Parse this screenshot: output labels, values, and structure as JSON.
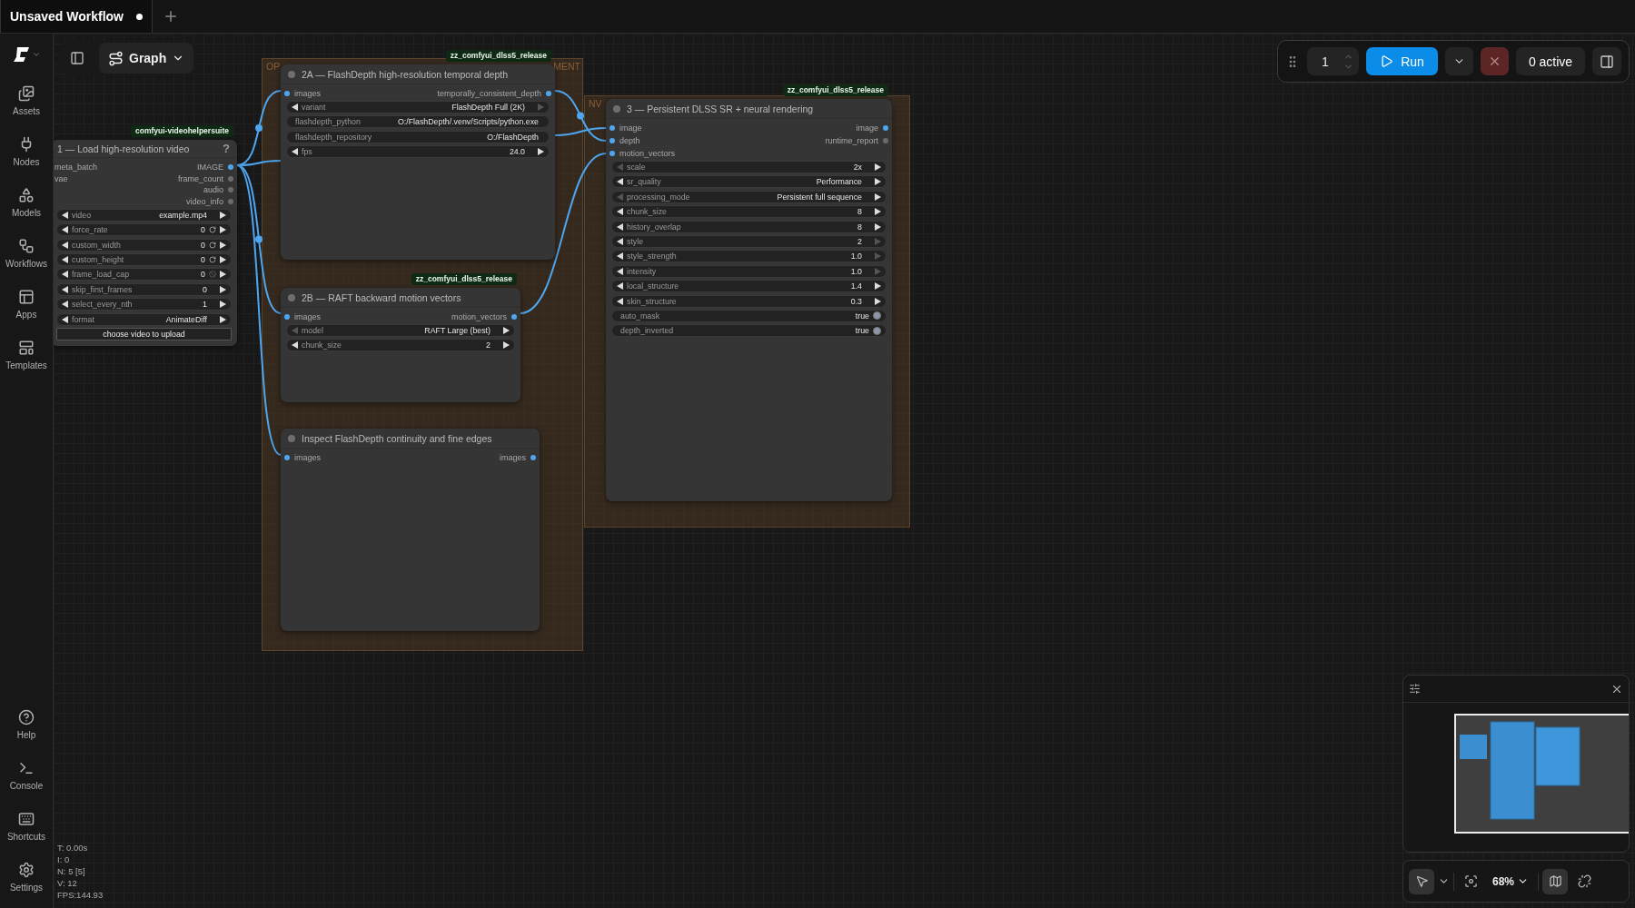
{
  "tabs": [
    {
      "label": "Unsaved Workflow",
      "selected": true,
      "unsaved": true
    }
  ],
  "sidebar": {
    "top_items": [
      {
        "kind": "assets",
        "label": "Assets"
      },
      {
        "kind": "nodes",
        "label": "Nodes"
      },
      {
        "kind": "models",
        "label": "Models"
      },
      {
        "kind": "workflows",
        "label": "Workflows"
      },
      {
        "kind": "apps",
        "label": "Apps"
      },
      {
        "kind": "templates",
        "label": "Templates"
      }
    ],
    "bottom_items": [
      {
        "kind": "help",
        "label": "Help"
      },
      {
        "kind": "console",
        "label": "Console"
      },
      {
        "kind": "shortcuts",
        "label": "Shortcuts"
      },
      {
        "kind": "settings",
        "label": "Settings"
      }
    ]
  },
  "view_menu": {
    "label": "Graph"
  },
  "toolbar": {
    "batch_count": "1",
    "run_label": "Run",
    "active_label": "0 active"
  },
  "groups": [
    {
      "title_start": "OP",
      "title_end": "MENT"
    },
    {
      "title_start": "NV"
    }
  ],
  "nodes": [
    {
      "badge": "comfyui-videohelpersuite",
      "title": "1 — Load high-resolution video",
      "dot": false,
      "help": "?",
      "inputs": [
        {
          "label": "meta_batch"
        },
        {
          "label": "vae"
        }
      ],
      "outputs": [
        {
          "label": "IMAGE",
          "connected": true
        },
        {
          "label": "frame_count",
          "connected": false
        },
        {
          "label": "audio",
          "connected": false
        },
        {
          "label": "video_info",
          "connected": false
        }
      ],
      "widgets": [
        {
          "kind": "stepper",
          "label": "video",
          "value": "example.mp4",
          "prev_disabled": false,
          "next_disabled": false
        },
        {
          "kind": "reset_stepper",
          "label": "force_rate",
          "value": "0",
          "prev_disabled": false,
          "next_disabled": false
        },
        {
          "kind": "reset_stepper",
          "label": "custom_width",
          "value": "0",
          "prev_disabled": false,
          "next_disabled": false
        },
        {
          "kind": "reset_stepper",
          "label": "custom_height",
          "value": "0",
          "prev_disabled": false,
          "next_disabled": false
        },
        {
          "kind": "blocked_stepper",
          "label": "frame_load_cap",
          "value": "0",
          "prev_disabled": false,
          "next_disabled": false
        },
        {
          "kind": "stepper",
          "label": "skip_first_frames",
          "value": "0",
          "prev_disabled": false,
          "next_disabled": false
        },
        {
          "kind": "stepper",
          "label": "select_every_nth",
          "value": "1",
          "prev_disabled": false,
          "next_disabled": false
        },
        {
          "kind": "stepper",
          "label": "format",
          "value": "AnimateDiff",
          "prev_disabled": false,
          "next_disabled": false
        },
        {
          "kind": "button",
          "label": "choose video to upload"
        }
      ]
    },
    {
      "badge": "zz_comfyui_dlss5_release",
      "title": "2A — FlashDepth high-resolution temporal depth",
      "dot": true,
      "inputs": [
        {
          "label": "images",
          "connected": true
        }
      ],
      "outputs": [
        {
          "label": "temporally_consistent_depth",
          "connected": true
        }
      ],
      "widgets": [
        {
          "kind": "stepper",
          "label": "variant",
          "value": "FlashDepth Full (2K)",
          "prev_disabled": false,
          "next_disabled": true
        },
        {
          "kind": "text",
          "label": "flashdepth_python",
          "value": "O:/FlashDepth/.venv/Scripts/python.exe"
        },
        {
          "kind": "text",
          "label": "flashdepth_repository",
          "value": "O:/FlashDepth"
        },
        {
          "kind": "stepper",
          "label": "fps",
          "value": "24.0",
          "prev_disabled": false,
          "next_disabled": false
        }
      ]
    },
    {
      "badge": "zz_comfyui_dlss5_release",
      "title": "2B — RAFT backward motion vectors",
      "dot": true,
      "inputs": [
        {
          "label": "images",
          "connected": true
        }
      ],
      "outputs": [
        {
          "label": "motion_vectors",
          "connected": true
        }
      ],
      "widgets": [
        {
          "kind": "stepper",
          "label": "model",
          "value": "RAFT Large (best)",
          "prev_disabled": true,
          "next_disabled": false
        },
        {
          "kind": "stepper",
          "label": "chunk_size",
          "value": "2",
          "prev_disabled": false,
          "next_disabled": false
        }
      ]
    },
    {
      "title": "Inspect FlashDepth continuity and fine edges",
      "dot": true,
      "inputs": [
        {
          "label": "images",
          "connected": true
        }
      ],
      "outputs": [
        {
          "label": "images",
          "connected": true
        }
      ]
    },
    {
      "badge": "zz_comfyui_dlss5_release",
      "title": "3 — Persistent DLSS SR + neural rendering",
      "dot": true,
      "inputs": [
        {
          "label": "image",
          "connected": true
        },
        {
          "label": "depth",
          "connected": true
        },
        {
          "label": "motion_vectors",
          "connected": true
        }
      ],
      "outputs": [
        {
          "label": "image",
          "connected": true
        },
        {
          "label": "runtime_report",
          "connected": false
        }
      ],
      "widgets": [
        {
          "kind": "stepper",
          "label": "scale",
          "value": "2x",
          "prev_disabled": true,
          "next_disabled": false
        },
        {
          "kind": "stepper",
          "label": "sr_quality",
          "value": "Performance",
          "prev_disabled": false,
          "next_disabled": false
        },
        {
          "kind": "stepper",
          "label": "processing_mode",
          "value": "Persistent full sequence",
          "prev_disabled": true,
          "next_disabled": false
        },
        {
          "kind": "stepper",
          "label": "chunk_size",
          "value": "8",
          "prev_disabled": false,
          "next_disabled": false
        },
        {
          "kind": "stepper",
          "label": "history_overlap",
          "value": "8",
          "prev_disabled": false,
          "next_disabled": false
        },
        {
          "kind": "stepper",
          "label": "style",
          "value": "2",
          "prev_disabled": false,
          "next_disabled": true
        },
        {
          "kind": "stepper",
          "label": "style_strength",
          "value": "1.0",
          "prev_disabled": false,
          "next_disabled": true
        },
        {
          "kind": "stepper",
          "label": "intensity",
          "value": "1.0",
          "prev_disabled": false,
          "next_disabled": true
        },
        {
          "kind": "stepper",
          "label": "local_structure",
          "value": "1.4",
          "prev_disabled": false,
          "next_disabled": false
        },
        {
          "kind": "stepper",
          "label": "skin_structure",
          "value": "0.3",
          "prev_disabled": false,
          "next_disabled": false
        },
        {
          "kind": "toggle",
          "label": "auto_mask",
          "value": "true",
          "on": true
        },
        {
          "kind": "toggle",
          "label": "depth_inverted",
          "value": "true",
          "on": true
        }
      ]
    }
  ],
  "stats": [
    "T: 0.00s",
    "I: 0",
    "N: 5 [5]",
    "V: 12",
    "FPS:144.93"
  ],
  "canvas_controls": {
    "pointer_selected": true,
    "zoom_label": "68%",
    "minimap_selected": true
  }
}
